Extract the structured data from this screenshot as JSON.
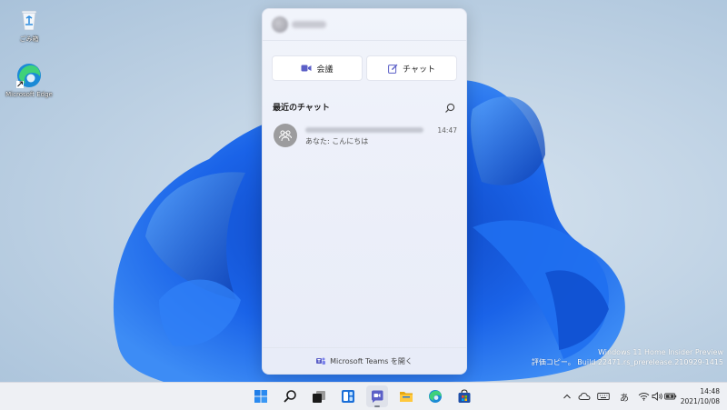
{
  "desktop": {
    "icons": [
      {
        "label": "ごみ箱",
        "icon": "recycle-bin-icon"
      },
      {
        "label": "Microsoft Edge",
        "icon": "edge-icon"
      }
    ],
    "watermark": {
      "line1": "Windows 11 Home Insider Preview",
      "line2": "評価コピー。 Build 22471.rs_prerelease.210929-1415"
    }
  },
  "chat": {
    "meet_label": "会議",
    "chat_label": "チャット",
    "section_title": "最近のチャット",
    "recent": [
      {
        "time": "14:47",
        "preview": "あなた: こんにちは"
      }
    ],
    "footer": "Microsoft Teams を開く"
  },
  "taskbar": {
    "apps": [
      "start-icon",
      "search-icon",
      "task-view-icon",
      "widgets-icon",
      "chat-icon",
      "file-explorer-icon",
      "edge-icon",
      "store-icon"
    ],
    "tray": {
      "ime": "あ"
    },
    "clock": {
      "time": "14:48",
      "date": "2021/10/08"
    }
  },
  "colors": {
    "accent": "#5b5fc7",
    "bloom_blue": "#1a5fe0",
    "taskbar": "#eef0f4"
  }
}
